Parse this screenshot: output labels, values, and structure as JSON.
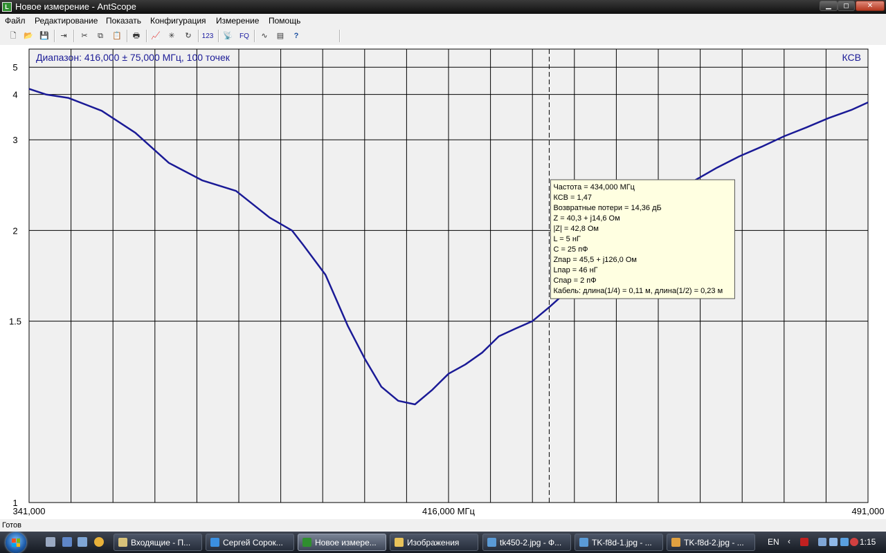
{
  "window": {
    "title": "Новое измерение - AntScope",
    "app_icon": "antscope-app-icon",
    "controls": {
      "minimize": "minimize-icon",
      "maximize": "maximize-icon",
      "close": "close-icon"
    }
  },
  "menu": [
    "Файл",
    "Редактирование",
    "Показать",
    "Конфигурация",
    "Измерение",
    "Помощь"
  ],
  "toolbar": {
    "buttons": [
      {
        "name": "new-file-button",
        "icon": "new-file-icon",
        "glyph": "🗋"
      },
      {
        "name": "open-file-button",
        "icon": "folder-open-icon",
        "glyph": "📂"
      },
      {
        "name": "save-button",
        "icon": "floppy-disk-icon",
        "glyph": "💾"
      },
      {
        "name": "export-button",
        "icon": "export-icon",
        "glyph": "⇥"
      },
      {
        "name": "cut-button",
        "icon": "scissors-icon",
        "glyph": "✂"
      },
      {
        "name": "copy-button",
        "icon": "copy-icon",
        "glyph": "⧉"
      },
      {
        "name": "paste-button",
        "icon": "paste-icon",
        "glyph": "📋"
      },
      {
        "name": "print-button",
        "icon": "printer-icon",
        "glyph": "🖶"
      },
      {
        "name": "graph-button",
        "icon": "graph-icon",
        "glyph": "📈"
      },
      {
        "name": "smith-chart-button",
        "icon": "asterisk-icon",
        "glyph": "✳"
      },
      {
        "name": "refresh-button",
        "icon": "refresh-icon",
        "glyph": "↻"
      },
      {
        "name": "numeric-display-button",
        "icon": "numbers-icon",
        "glyph": "123"
      },
      {
        "name": "antenna-button",
        "icon": "antenna-icon",
        "glyph": "📡"
      },
      {
        "name": "frequency-button",
        "icon": "fq-icon",
        "glyph": "FQ"
      },
      {
        "name": "waveform-button",
        "icon": "waveform-icon",
        "glyph": "∿"
      },
      {
        "name": "notes-button",
        "icon": "notes-icon",
        "glyph": "▤"
      },
      {
        "name": "help-button",
        "icon": "help-icon",
        "glyph": "?"
      }
    ]
  },
  "colors": {
    "plot_bg": "#f0f0f0",
    "grid": "#000000",
    "curve": "#1a1a96",
    "label_text": "#1a1a96",
    "tooltip_bg": "#ffffe1"
  },
  "chart_data": {
    "type": "line",
    "header_label": "Диапазон: 416,000 ± 75,000 МГц, 100 точек",
    "series": [
      {
        "name": "КСВ",
        "x": [
          341,
          344,
          348,
          354,
          360,
          366,
          372,
          378,
          384,
          388,
          390,
          394,
          398,
          401,
          404,
          407,
          410,
          413,
          416,
          419,
          422,
          425,
          428,
          431,
          434,
          437,
          440,
          444,
          448,
          452,
          456,
          460,
          464,
          468,
          472,
          476,
          480,
          484,
          488,
          491
        ],
        "values": [
          4.17,
          4.0,
          3.9,
          3.57,
          3.12,
          2.66,
          2.45,
          2.34,
          2.1,
          2.0,
          1.9,
          1.72,
          1.48,
          1.36,
          1.27,
          1.23,
          1.22,
          1.26,
          1.31,
          1.34,
          1.38,
          1.44,
          1.47,
          1.5,
          1.56,
          1.63,
          1.72,
          1.84,
          1.98,
          2.15,
          2.31,
          2.45,
          2.6,
          2.75,
          2.89,
          3.06,
          3.22,
          3.41,
          3.59,
          3.78
        ]
      }
    ],
    "x_ticks": [
      "341,000",
      "416,000 МГц",
      "491,000"
    ],
    "y_ticks": [
      "1",
      "1.5",
      "2",
      "3",
      "4",
      "5"
    ],
    "xlim": [
      341,
      491
    ],
    "ylim": [
      1,
      6
    ],
    "y_scale": "reciprocal",
    "y_axis_name": "КСВ",
    "vertical_grid_divisions": 20,
    "grid": true,
    "cursor_x": 434,
    "tooltip": [
      "Частота = 434,000 МГц",
      "КСВ = 1,47",
      "Возвратные потери = 14,36 дБ",
      "Z = 40,3 + j14,6 Ом",
      "|Z| = 42,8 Ом",
      "L = 5 нГ",
      "C = 25 пФ",
      "Zпар = 45,5 + j126,0 Ом",
      "Lпар = 46 нГ",
      "Cпар = 2 пФ",
      "Кабель: длина(1/4) = 0,11 м, длина(1/2) = 0,23 м"
    ]
  },
  "status": {
    "text": "Готов"
  },
  "taskbar": {
    "start_icon": "windows-start-icon",
    "quick_launch": [
      "show-desktop-icon",
      "switch-windows-icon",
      "monitor-icon",
      "chrome-icon"
    ],
    "tasks": [
      {
        "label": "Входящие - П...",
        "icon": "mail-icon",
        "active": false
      },
      {
        "label": "Сергей Сорок...",
        "icon": "ie-icon",
        "active": false
      },
      {
        "label": "Новое измере...",
        "icon": "antscope-app-icon",
        "active": true
      },
      {
        "label": "Изображения",
        "icon": "folder-icon",
        "active": false
      },
      {
        "label": "tk450-2.jpg - Ф...",
        "icon": "image-viewer-icon",
        "active": false
      },
      {
        "label": "TK-f8d-1.jpg - ...",
        "icon": "image-viewer-icon",
        "active": false
      },
      {
        "label": "TK-f8d-2.jpg - ...",
        "icon": "paint-icon",
        "active": false
      }
    ],
    "tray": {
      "language": "EN",
      "clock": "1:15"
    }
  }
}
